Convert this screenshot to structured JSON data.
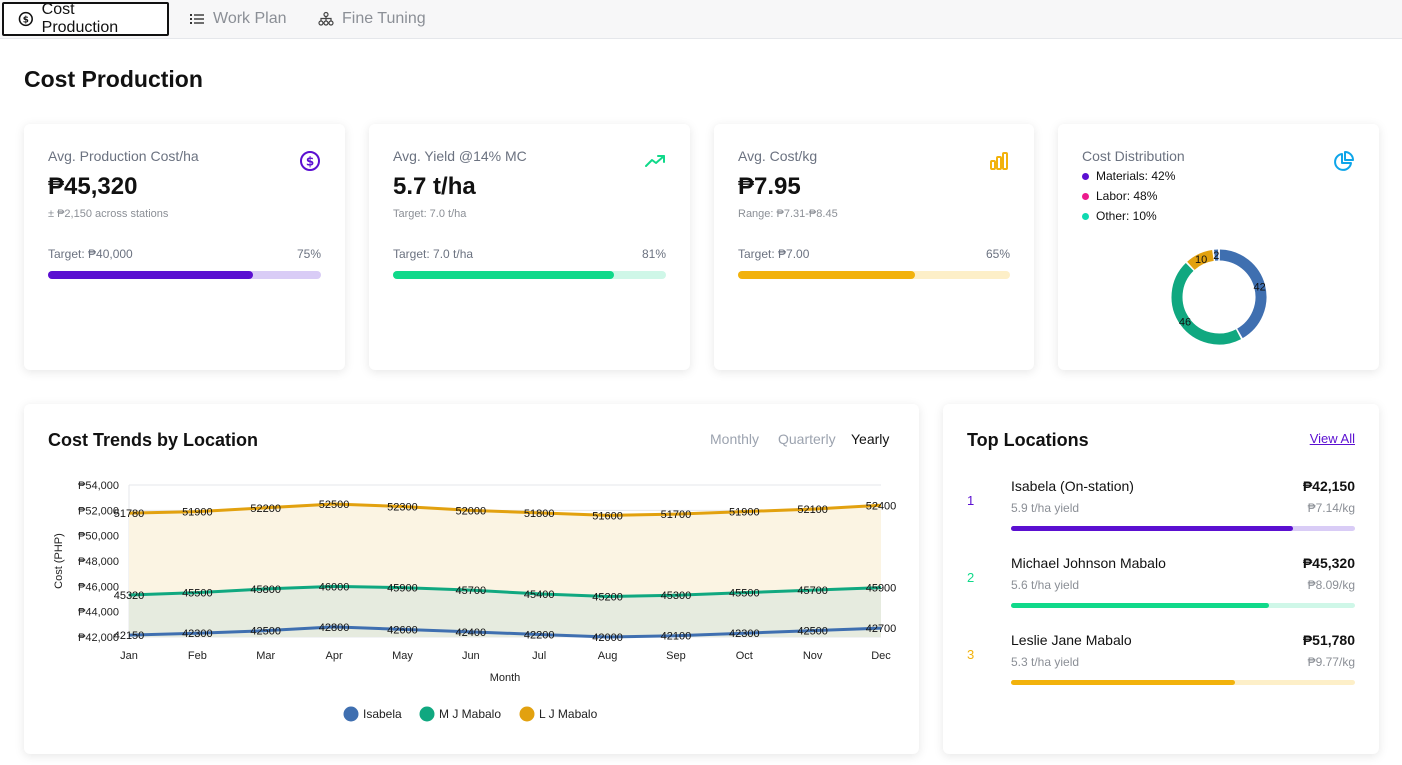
{
  "tabs": [
    {
      "label": "Cost Production",
      "icon": "dollar-circle-icon",
      "active": true
    },
    {
      "label": "Work Plan",
      "icon": "list-icon",
      "active": false
    },
    {
      "label": "Fine Tuning",
      "icon": "hierarchy-icon",
      "active": false
    }
  ],
  "page": {
    "title": "Cost Production"
  },
  "kpis": [
    {
      "label": "Avg. Production Cost/ha",
      "value": "₱45,320",
      "sub": "± ₱2,150 across stations",
      "target": "Target: ₱40,000",
      "percent_label": "75%",
      "progress": 0.75,
      "color": "#5b0fd1",
      "track_color": "#d9ccf6",
      "icon": "dollar-circle-icon"
    },
    {
      "label": "Avg. Yield @14% MC",
      "value": "5.7 t/ha",
      "sub": "Target: 7.0 t/ha",
      "target": "Target: 7.0 t/ha",
      "percent_label": "81%",
      "progress": 0.81,
      "color": "#10d98a",
      "track_color": "#cff7e8",
      "icon": "trending-up-icon"
    },
    {
      "label": "Avg. Cost/kg",
      "value": "₱7.95",
      "sub": "Range: ₱7.31-₱8.45",
      "target": "Target: ₱7.00",
      "percent_label": "65%",
      "progress": 0.65,
      "color": "#f2b20c",
      "track_color": "#fdefc8",
      "icon": "bar-chart-icon"
    }
  ],
  "distribution": {
    "label": "Cost Distribution",
    "icon": "pie-chart-icon",
    "legend": [
      {
        "text": "Materials: 42%",
        "color": "#5b0fd1"
      },
      {
        "text": "Labor: 48%",
        "color": "#ec1c8c"
      },
      {
        "text": "Other: 10%",
        "color": "#10d9b0"
      }
    ],
    "donut": {
      "slices": [
        {
          "value": 42,
          "label": "42",
          "color": "#3f6fb0"
        },
        {
          "value": 46,
          "label": "46",
          "color": "#10a880"
        },
        {
          "value": 10,
          "label": "10",
          "color": "#e2a10f"
        },
        {
          "value": 2,
          "label": "2",
          "color": "#3f6fb0"
        }
      ]
    }
  },
  "trends": {
    "title": "Cost Trends by Location",
    "periods": [
      {
        "label": "Monthly",
        "active": false
      },
      {
        "label": "Quarterly",
        "active": false
      },
      {
        "label": "Yearly",
        "active": true
      }
    ]
  },
  "chart_data": {
    "type": "area",
    "x": [
      "Jan",
      "Feb",
      "Mar",
      "Apr",
      "May",
      "Jun",
      "Jul",
      "Aug",
      "Sep",
      "Oct",
      "Nov",
      "Dec"
    ],
    "xlabel": "Month",
    "ylabel": "Cost (PHP)",
    "ylim": [
      42000,
      54000
    ],
    "yticks": [
      "₱42,000",
      "₱44,000",
      "₱46,000",
      "₱48,000",
      "₱50,000",
      "₱52,000",
      "₱54,000"
    ],
    "grid": true,
    "legend_position": "bottom",
    "series": [
      {
        "name": "Isabela",
        "color": "#3f6fb0",
        "fill": "#e6ebdf",
        "values": [
          42150,
          42300,
          42500,
          42800,
          42600,
          42400,
          42200,
          42000,
          42100,
          42300,
          42500,
          42700
        ]
      },
      {
        "name": "M J Mabalo",
        "color": "#10a880",
        "fill": "#e6ebdf",
        "values": [
          45320,
          45500,
          45800,
          46000,
          45900,
          45700,
          45400,
          45200,
          45300,
          45500,
          45700,
          45900
        ]
      },
      {
        "name": "L J Mabalo",
        "color": "#e2a10f",
        "fill": "#fbf4e3",
        "values": [
          51780,
          51900,
          52200,
          52500,
          52300,
          52000,
          51800,
          51600,
          51700,
          51900,
          52100,
          52400
        ]
      }
    ]
  },
  "top_locations": {
    "title": "Top Locations",
    "view_all": "View All",
    "items": [
      {
        "rank": "1",
        "name": "Isabela (On-station)",
        "cost": "₱42,150",
        "yield": "5.9 t/ha yield",
        "per_kg": "₱7.14/kg",
        "progress": 0.82,
        "color": "#5b0fd1",
        "track_color": "#d9ccf6"
      },
      {
        "rank": "2",
        "name": "Michael Johnson Mabalo",
        "cost": "₱45,320",
        "yield": "5.6 t/ha yield",
        "per_kg": "₱8.09/kg",
        "progress": 0.75,
        "color": "#10d98a",
        "track_color": "#cff7e8"
      },
      {
        "rank": "3",
        "name": "Leslie Jane Mabalo",
        "cost": "₱51,780",
        "yield": "5.3 t/ha yield",
        "per_kg": "₱9.77/kg",
        "progress": 0.65,
        "color": "#f2b20c",
        "track_color": "#fdefc8"
      }
    ]
  }
}
